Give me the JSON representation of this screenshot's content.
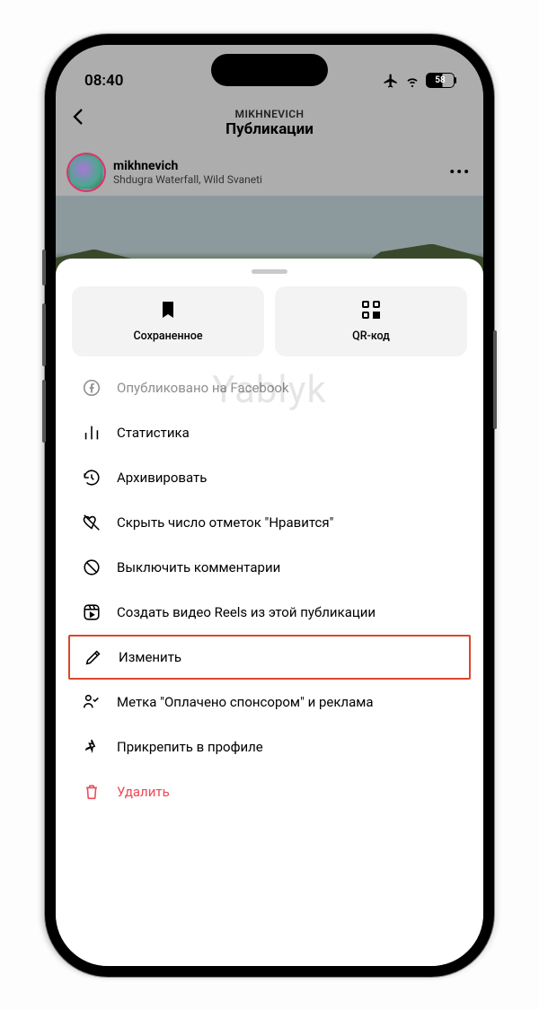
{
  "status": {
    "time": "08:40",
    "battery_pct": "58"
  },
  "header": {
    "small": "MIKHNEVICH",
    "big": "Публикации"
  },
  "post": {
    "username": "mikhnevich",
    "location": "Shdugra Waterfall, Wild Svaneti"
  },
  "sheet": {
    "saved_label": "Сохраненное",
    "qr_label": "QR-код",
    "items": [
      {
        "label": "Опубликовано на Facebook",
        "icon": "facebook",
        "state": "disabled"
      },
      {
        "label": "Статистика",
        "icon": "stats"
      },
      {
        "label": "Архивировать",
        "icon": "archive"
      },
      {
        "label": "Скрыть число отметок \"Нравится\"",
        "icon": "hide-like"
      },
      {
        "label": "Выключить комментарии",
        "icon": "comments-off"
      },
      {
        "label": "Создать видео Reels из этой публикации",
        "icon": "reels"
      },
      {
        "label": "Изменить",
        "icon": "edit",
        "highlight": true
      },
      {
        "label": "Метка \"Оплачено спонсором\" и реклама",
        "icon": "sponsor"
      },
      {
        "label": "Прикрепить в профиле",
        "icon": "pin"
      },
      {
        "label": "Удалить",
        "icon": "delete",
        "state": "danger"
      }
    ]
  },
  "watermark": "Yablyk"
}
